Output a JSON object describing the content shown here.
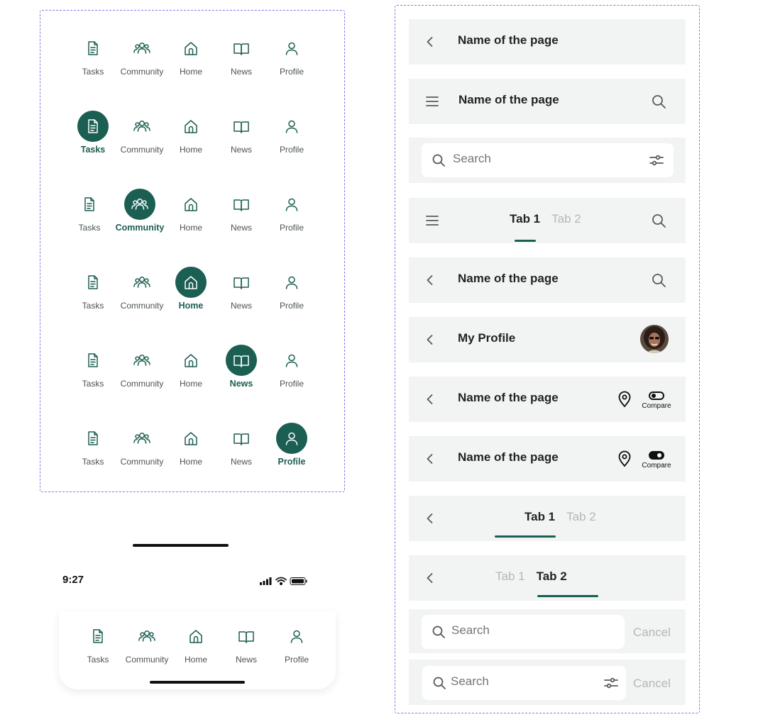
{
  "nav_labels": {
    "tasks": "Tasks",
    "community": "Community",
    "home": "Home",
    "news": "News",
    "profile": "Profile"
  },
  "nav_variants": [
    {
      "active": "none"
    },
    {
      "active": "tasks"
    },
    {
      "active": "community"
    },
    {
      "active": "home"
    },
    {
      "active": "news"
    },
    {
      "active": "profile"
    }
  ],
  "status_bar": {
    "time": "9:27"
  },
  "headers": {
    "back_title": "Name of the page",
    "menu_title": "Name of the page",
    "search_placeholder": "Search",
    "tab1": "Tab 1",
    "tab2": "Tab 2",
    "back_search_title": "Name of the page",
    "profile_title": "My Profile",
    "compare_title_off": "Name of the page",
    "compare_title_on": "Name of the page",
    "compare_label": "Compare",
    "cancel_label": "Cancel"
  },
  "colors": {
    "brand": "#1b5e52",
    "header_bg": "#f1f4f3",
    "tab_inactive": "#b3b8b6"
  }
}
